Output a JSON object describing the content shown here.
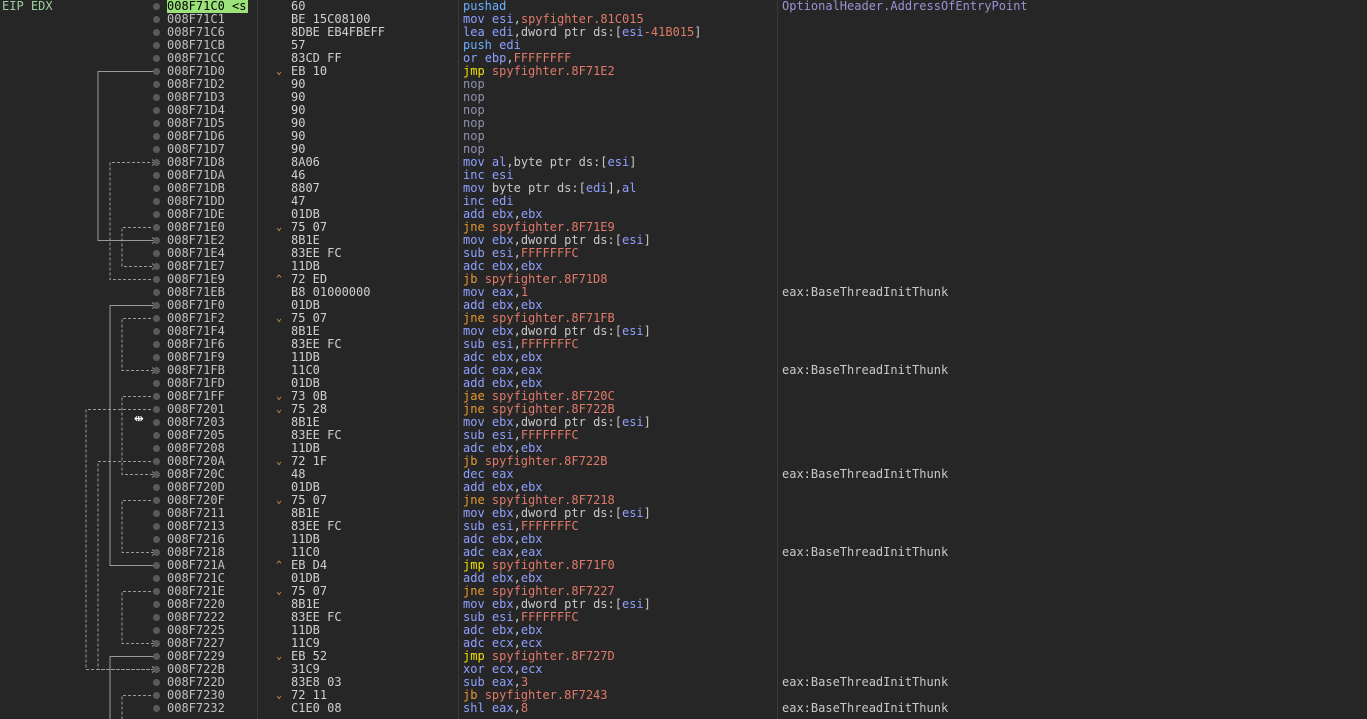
{
  "register_label": "EIP EDX",
  "rows": [
    {
      "addr": "008F71C0 <s",
      "bytes": "60",
      "arrow": "",
      "mn": "pushad",
      "mt": "push",
      "ops": [],
      "comment": "OptionalHeader.AddressOfEntryPoint",
      "eip": true
    },
    {
      "addr": "008F71C1",
      "bytes": "BE 15C08100",
      "arrow": "",
      "mn": "mov",
      "mt": "mov",
      "ops": [
        [
          "r",
          "esi"
        ],
        [
          "p",
          ","
        ],
        [
          "t",
          "spyfighter.81C015"
        ]
      ],
      "comment": ""
    },
    {
      "addr": "008F71C6",
      "bytes": "8DBE EB4FBEFF",
      "arrow": "",
      "mn": "lea",
      "mt": "mov",
      "ops": [
        [
          "r",
          "edi"
        ],
        [
          "p",
          ",dword ptr ds:["
        ],
        [
          "r",
          "esi"
        ],
        [
          "t",
          "-41B015"
        ],
        [
          "p",
          "]"
        ]
      ],
      "comment": ""
    },
    {
      "addr": "008F71CB",
      "bytes": "57",
      "arrow": "",
      "mn": "push",
      "mt": "push",
      "ops": [
        [
          "r",
          "edi"
        ]
      ],
      "comment": ""
    },
    {
      "addr": "008F71CC",
      "bytes": "83CD FF",
      "arrow": "",
      "mn": "or",
      "mt": "mov",
      "ops": [
        [
          "r",
          "ebp"
        ],
        [
          "p",
          ","
        ],
        [
          "t",
          "FFFFFFFF"
        ]
      ],
      "comment": ""
    },
    {
      "addr": "008F71D0",
      "bytes": "EB 10",
      "arrow": "v",
      "mn": "jmp",
      "mt": "jmp",
      "ops": [
        [
          "t",
          "spyfighter.8F71E2"
        ]
      ],
      "comment": ""
    },
    {
      "addr": "008F71D2",
      "bytes": "90",
      "arrow": "",
      "mn": "nop",
      "mt": "nop",
      "ops": [],
      "comment": ""
    },
    {
      "addr": "008F71D3",
      "bytes": "90",
      "arrow": "",
      "mn": "nop",
      "mt": "nop",
      "ops": [],
      "comment": ""
    },
    {
      "addr": "008F71D4",
      "bytes": "90",
      "arrow": "",
      "mn": "nop",
      "mt": "nop",
      "ops": [],
      "comment": ""
    },
    {
      "addr": "008F71D5",
      "bytes": "90",
      "arrow": "",
      "mn": "nop",
      "mt": "nop",
      "ops": [],
      "comment": ""
    },
    {
      "addr": "008F71D6",
      "bytes": "90",
      "arrow": "",
      "mn": "nop",
      "mt": "nop",
      "ops": [],
      "comment": ""
    },
    {
      "addr": "008F71D7",
      "bytes": "90",
      "arrow": "",
      "mn": "nop",
      "mt": "nop",
      "ops": [],
      "comment": ""
    },
    {
      "addr": "008F71D8",
      "bytes": "8A06",
      "arrow": "",
      "mn": "mov",
      "mt": "mov",
      "ops": [
        [
          "r",
          "al"
        ],
        [
          "p",
          ",byte ptr ds:["
        ],
        [
          "r",
          "esi"
        ],
        [
          "p",
          "]"
        ]
      ],
      "comment": ""
    },
    {
      "addr": "008F71DA",
      "bytes": "46",
      "arrow": "",
      "mn": "inc",
      "mt": "mov",
      "ops": [
        [
          "r",
          "esi"
        ]
      ],
      "comment": ""
    },
    {
      "addr": "008F71DB",
      "bytes": "8807",
      "arrow": "",
      "mn": "mov",
      "mt": "mov",
      "ops": [
        [
          "p",
          "byte ptr ds:["
        ],
        [
          "r",
          "edi"
        ],
        [
          "p",
          "],"
        ],
        [
          "r",
          "al"
        ]
      ],
      "comment": ""
    },
    {
      "addr": "008F71DD",
      "bytes": "47",
      "arrow": "",
      "mn": "inc",
      "mt": "mov",
      "ops": [
        [
          "r",
          "edi"
        ]
      ],
      "comment": ""
    },
    {
      "addr": "008F71DE",
      "bytes": "01DB",
      "arrow": "",
      "mn": "add",
      "mt": "mov",
      "ops": [
        [
          "r",
          "ebx"
        ],
        [
          "p",
          ","
        ],
        [
          "r",
          "ebx"
        ]
      ],
      "comment": ""
    },
    {
      "addr": "008F71E0",
      "bytes": "75 07",
      "arrow": "v",
      "mn": "jne",
      "mt": "jcc",
      "ops": [
        [
          "t",
          "spyfighter.8F71E9"
        ]
      ],
      "comment": ""
    },
    {
      "addr": "008F71E2",
      "bytes": "8B1E",
      "arrow": "",
      "mn": "mov",
      "mt": "mov",
      "ops": [
        [
          "r",
          "ebx"
        ],
        [
          "p",
          ",dword ptr ds:["
        ],
        [
          "r",
          "esi"
        ],
        [
          "p",
          "]"
        ]
      ],
      "comment": ""
    },
    {
      "addr": "008F71E4",
      "bytes": "83EE FC",
      "arrow": "",
      "mn": "sub",
      "mt": "mov",
      "ops": [
        [
          "r",
          "esi"
        ],
        [
          "p",
          ","
        ],
        [
          "t",
          "FFFFFFFC"
        ]
      ],
      "comment": ""
    },
    {
      "addr": "008F71E7",
      "bytes": "11DB",
      "arrow": "",
      "mn": "adc",
      "mt": "mov",
      "ops": [
        [
          "r",
          "ebx"
        ],
        [
          "p",
          ","
        ],
        [
          "r",
          "ebx"
        ]
      ],
      "comment": ""
    },
    {
      "addr": "008F71E9",
      "bytes": "72 ED",
      "arrow": "^",
      "mn": "jb",
      "mt": "jcc",
      "ops": [
        [
          "t",
          "spyfighter.8F71D8"
        ]
      ],
      "comment": ""
    },
    {
      "addr": "008F71EB",
      "bytes": "B8 01000000",
      "arrow": "",
      "mn": "mov",
      "mt": "mov",
      "ops": [
        [
          "r",
          "eax"
        ],
        [
          "p",
          ","
        ],
        [
          "t",
          "1"
        ]
      ],
      "comment": "eax:BaseThreadInitThunk"
    },
    {
      "addr": "008F71F0",
      "bytes": "01DB",
      "arrow": "",
      "mn": "add",
      "mt": "mov",
      "ops": [
        [
          "r",
          "ebx"
        ],
        [
          "p",
          ","
        ],
        [
          "r",
          "ebx"
        ]
      ],
      "comment": ""
    },
    {
      "addr": "008F71F2",
      "bytes": "75 07",
      "arrow": "v",
      "mn": "jne",
      "mt": "jcc",
      "ops": [
        [
          "t",
          "spyfighter.8F71FB"
        ]
      ],
      "comment": ""
    },
    {
      "addr": "008F71F4",
      "bytes": "8B1E",
      "arrow": "",
      "mn": "mov",
      "mt": "mov",
      "ops": [
        [
          "r",
          "ebx"
        ],
        [
          "p",
          ",dword ptr ds:["
        ],
        [
          "r",
          "esi"
        ],
        [
          "p",
          "]"
        ]
      ],
      "comment": ""
    },
    {
      "addr": "008F71F6",
      "bytes": "83EE FC",
      "arrow": "",
      "mn": "sub",
      "mt": "mov",
      "ops": [
        [
          "r",
          "esi"
        ],
        [
          "p",
          ","
        ],
        [
          "t",
          "FFFFFFFC"
        ]
      ],
      "comment": ""
    },
    {
      "addr": "008F71F9",
      "bytes": "11DB",
      "arrow": "",
      "mn": "adc",
      "mt": "mov",
      "ops": [
        [
          "r",
          "ebx"
        ],
        [
          "p",
          ","
        ],
        [
          "r",
          "ebx"
        ]
      ],
      "comment": ""
    },
    {
      "addr": "008F71FB",
      "bytes": "11C0",
      "arrow": "",
      "mn": "adc",
      "mt": "mov",
      "ops": [
        [
          "r",
          "eax"
        ],
        [
          "p",
          ","
        ],
        [
          "r",
          "eax"
        ]
      ],
      "comment": "eax:BaseThreadInitThunk"
    },
    {
      "addr": "008F71FD",
      "bytes": "01DB",
      "arrow": "",
      "mn": "add",
      "mt": "mov",
      "ops": [
        [
          "r",
          "ebx"
        ],
        [
          "p",
          ","
        ],
        [
          "r",
          "ebx"
        ]
      ],
      "comment": ""
    },
    {
      "addr": "008F71FF",
      "bytes": "73 0B",
      "arrow": "v",
      "mn": "jae",
      "mt": "jcc",
      "ops": [
        [
          "t",
          "spyfighter.8F720C"
        ]
      ],
      "comment": ""
    },
    {
      "addr": "008F7201",
      "bytes": "75 28",
      "arrow": "v",
      "mn": "jne",
      "mt": "jcc",
      "ops": [
        [
          "t",
          "spyfighter.8F722B"
        ]
      ],
      "comment": ""
    },
    {
      "addr": "008F7203",
      "bytes": "8B1E",
      "arrow": "",
      "mn": "mov",
      "mt": "mov",
      "ops": [
        [
          "r",
          "ebx"
        ],
        [
          "p",
          ",dword ptr ds:["
        ],
        [
          "r",
          "esi"
        ],
        [
          "p",
          "]"
        ]
      ],
      "comment": ""
    },
    {
      "addr": "008F7205",
      "bytes": "83EE FC",
      "arrow": "",
      "mn": "sub",
      "mt": "mov",
      "ops": [
        [
          "r",
          "esi"
        ],
        [
          "p",
          ","
        ],
        [
          "t",
          "FFFFFFFC"
        ]
      ],
      "comment": ""
    },
    {
      "addr": "008F7208",
      "bytes": "11DB",
      "arrow": "",
      "mn": "adc",
      "mt": "mov",
      "ops": [
        [
          "r",
          "ebx"
        ],
        [
          "p",
          ","
        ],
        [
          "r",
          "ebx"
        ]
      ],
      "comment": ""
    },
    {
      "addr": "008F720A",
      "bytes": "72 1F",
      "arrow": "v",
      "mn": "jb",
      "mt": "jcc",
      "ops": [
        [
          "t",
          "spyfighter.8F722B"
        ]
      ],
      "comment": ""
    },
    {
      "addr": "008F720C",
      "bytes": "48",
      "arrow": "",
      "mn": "dec",
      "mt": "mov",
      "ops": [
        [
          "r",
          "eax"
        ]
      ],
      "comment": "eax:BaseThreadInitThunk"
    },
    {
      "addr": "008F720D",
      "bytes": "01DB",
      "arrow": "",
      "mn": "add",
      "mt": "mov",
      "ops": [
        [
          "r",
          "ebx"
        ],
        [
          "p",
          ","
        ],
        [
          "r",
          "ebx"
        ]
      ],
      "comment": ""
    },
    {
      "addr": "008F720F",
      "bytes": "75 07",
      "arrow": "v",
      "mn": "jne",
      "mt": "jcc",
      "ops": [
        [
          "t",
          "spyfighter.8F7218"
        ]
      ],
      "comment": ""
    },
    {
      "addr": "008F7211",
      "bytes": "8B1E",
      "arrow": "",
      "mn": "mov",
      "mt": "mov",
      "ops": [
        [
          "r",
          "ebx"
        ],
        [
          "p",
          ",dword ptr ds:["
        ],
        [
          "r",
          "esi"
        ],
        [
          "p",
          "]"
        ]
      ],
      "comment": ""
    },
    {
      "addr": "008F7213",
      "bytes": "83EE FC",
      "arrow": "",
      "mn": "sub",
      "mt": "mov",
      "ops": [
        [
          "r",
          "esi"
        ],
        [
          "p",
          ","
        ],
        [
          "t",
          "FFFFFFFC"
        ]
      ],
      "comment": ""
    },
    {
      "addr": "008F7216",
      "bytes": "11DB",
      "arrow": "",
      "mn": "adc",
      "mt": "mov",
      "ops": [
        [
          "r",
          "ebx"
        ],
        [
          "p",
          ","
        ],
        [
          "r",
          "ebx"
        ]
      ],
      "comment": ""
    },
    {
      "addr": "008F7218",
      "bytes": "11C0",
      "arrow": "",
      "mn": "adc",
      "mt": "mov",
      "ops": [
        [
          "r",
          "eax"
        ],
        [
          "p",
          ","
        ],
        [
          "r",
          "eax"
        ]
      ],
      "comment": "eax:BaseThreadInitThunk"
    },
    {
      "addr": "008F721A",
      "bytes": "EB D4",
      "arrow": "^",
      "mn": "jmp",
      "mt": "jmp",
      "ops": [
        [
          "t",
          "spyfighter.8F71F0"
        ]
      ],
      "comment": ""
    },
    {
      "addr": "008F721C",
      "bytes": "01DB",
      "arrow": "",
      "mn": "add",
      "mt": "mov",
      "ops": [
        [
          "r",
          "ebx"
        ],
        [
          "p",
          ","
        ],
        [
          "r",
          "ebx"
        ]
      ],
      "comment": ""
    },
    {
      "addr": "008F721E",
      "bytes": "75 07",
      "arrow": "v",
      "mn": "jne",
      "mt": "jcc",
      "ops": [
        [
          "t",
          "spyfighter.8F7227"
        ]
      ],
      "comment": ""
    },
    {
      "addr": "008F7220",
      "bytes": "8B1E",
      "arrow": "",
      "mn": "mov",
      "mt": "mov",
      "ops": [
        [
          "r",
          "ebx"
        ],
        [
          "p",
          ",dword ptr ds:["
        ],
        [
          "r",
          "esi"
        ],
        [
          "p",
          "]"
        ]
      ],
      "comment": ""
    },
    {
      "addr": "008F7222",
      "bytes": "83EE FC",
      "arrow": "",
      "mn": "sub",
      "mt": "mov",
      "ops": [
        [
          "r",
          "esi"
        ],
        [
          "p",
          ","
        ],
        [
          "t",
          "FFFFFFFC"
        ]
      ],
      "comment": ""
    },
    {
      "addr": "008F7225",
      "bytes": "11DB",
      "arrow": "",
      "mn": "adc",
      "mt": "mov",
      "ops": [
        [
          "r",
          "ebx"
        ],
        [
          "p",
          ","
        ],
        [
          "r",
          "ebx"
        ]
      ],
      "comment": ""
    },
    {
      "addr": "008F7227",
      "bytes": "11C9",
      "arrow": "",
      "mn": "adc",
      "mt": "mov",
      "ops": [
        [
          "r",
          "ecx"
        ],
        [
          "p",
          ","
        ],
        [
          "r",
          "ecx"
        ]
      ],
      "comment": ""
    },
    {
      "addr": "008F7229",
      "bytes": "EB 52",
      "arrow": "v",
      "mn": "jmp",
      "mt": "jmp",
      "ops": [
        [
          "t",
          "spyfighter.8F727D"
        ]
      ],
      "comment": ""
    },
    {
      "addr": "008F722B",
      "bytes": "31C9",
      "arrow": "",
      "mn": "xor",
      "mt": "mov",
      "ops": [
        [
          "r",
          "ecx"
        ],
        [
          "p",
          ","
        ],
        [
          "r",
          "ecx"
        ]
      ],
      "comment": ""
    },
    {
      "addr": "008F722D",
      "bytes": "83E8 03",
      "arrow": "",
      "mn": "sub",
      "mt": "mov",
      "ops": [
        [
          "r",
          "eax"
        ],
        [
          "p",
          ","
        ],
        [
          "t",
          "3"
        ]
      ],
      "comment": "eax:BaseThreadInitThunk"
    },
    {
      "addr": "008F7230",
      "bytes": "72 11",
      "arrow": "v",
      "mn": "jb",
      "mt": "jcc",
      "ops": [
        [
          "t",
          "spyfighter.8F7243"
        ]
      ],
      "comment": ""
    },
    {
      "addr": "008F7232",
      "bytes": "C1E0 08",
      "arrow": "",
      "mn": "shl",
      "mt": "mov",
      "ops": [
        [
          "r",
          "eax"
        ],
        [
          "p",
          ","
        ],
        [
          "t",
          "8"
        ]
      ],
      "comment": "eax:BaseThreadInitThunk"
    }
  ],
  "jumps": [
    {
      "from": 5,
      "to": 18,
      "style": "solid"
    },
    {
      "from": 17,
      "to": 20,
      "style": "dashed"
    },
    {
      "from": 21,
      "to": 12,
      "style": "dashed"
    },
    {
      "from": 24,
      "to": 28,
      "style": "dashed"
    },
    {
      "from": 30,
      "to": 36,
      "style": "dashed"
    },
    {
      "from": 31,
      "to": 51,
      "style": "dashed"
    },
    {
      "from": 35,
      "to": 51,
      "style": "dashed"
    },
    {
      "from": 38,
      "to": 42,
      "style": "dashed"
    },
    {
      "from": 43,
      "to": 23,
      "style": "solid"
    },
    {
      "from": 45,
      "to": 49,
      "style": "dashed"
    },
    {
      "from": 50,
      "to": 56,
      "style": "solid"
    },
    {
      "from": 53,
      "to": 56,
      "style": "dashed"
    }
  ],
  "colors": {
    "background": "#262626",
    "eip_highlight": "#9be27a",
    "mnemonic": "#8fa0ff",
    "jmp": "#f0e000",
    "jcc": "#e79a30",
    "immediate": "#e07a6a"
  }
}
